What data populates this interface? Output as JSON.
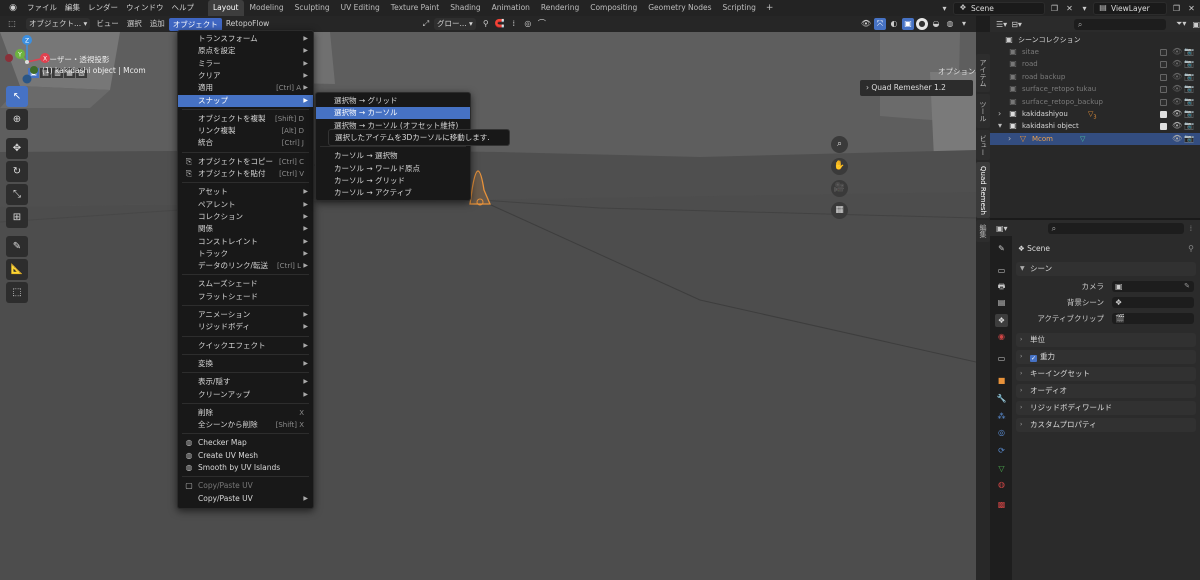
{
  "topbar": {
    "menus": [
      "ファイル",
      "編集",
      "レンダー",
      "ウィンドウ",
      "ヘルプ"
    ],
    "workspaces": [
      "Layout",
      "Modeling",
      "Sculpting",
      "UV Editing",
      "Texture Paint",
      "Shading",
      "Animation",
      "Rendering",
      "Compositing",
      "Geometry Nodes",
      "Scripting"
    ],
    "active_workspace": "Layout",
    "add_tab": "+",
    "scene_value": "Scene",
    "viewlayer_value": "ViewLayer"
  },
  "viewport_header": {
    "mode": "オブジェクト...",
    "menus": [
      "ビュー",
      "選択",
      "追加",
      "オブジェクト",
      "RetopoFlow"
    ],
    "active_menu": "オブジェクト",
    "transform_orientation": "グロー...",
    "options_label": "オプション"
  },
  "viewport": {
    "view_name": "ユーザー・透視投影",
    "object_info": "(1) kakidashi object | Mcom",
    "quad_remesher": "Quad Remesher 1.2",
    "gizmo_axes": {
      "x": "X",
      "y": "Y",
      "z": "Z"
    }
  },
  "sidebar_tabs": [
    "アイテム",
    "ツール",
    "ビュー",
    "Quad Remesh",
    "編集"
  ],
  "active_sidebar_tab": "Quad Remesh",
  "object_menu": {
    "items": [
      {
        "label": "トランスフォーム",
        "shortcut": "",
        "submenu": true
      },
      {
        "label": "原点を設定",
        "shortcut": "",
        "submenu": true
      },
      {
        "label": "ミラー",
        "shortcut": "",
        "submenu": true
      },
      {
        "label": "クリア",
        "shortcut": "",
        "submenu": true
      },
      {
        "label": "適用",
        "shortcut": "[Ctrl] A",
        "submenu": true
      },
      {
        "label": "スナップ",
        "shortcut": "",
        "submenu": true
      },
      {
        "label": "オブジェクトを複製",
        "shortcut": "[Shift] D",
        "submenu": false
      },
      {
        "label": "リンク複製",
        "shortcut": "[Alt] D",
        "submenu": false
      },
      {
        "label": "統合",
        "shortcut": "[Ctrl] J",
        "submenu": false
      },
      {
        "label": "オブジェクトをコピー",
        "shortcut": "[Ctrl] C",
        "submenu": false
      },
      {
        "label": "オブジェクトを貼付",
        "shortcut": "[Ctrl] V",
        "submenu": false
      },
      {
        "label": "アセット",
        "shortcut": "",
        "submenu": true
      },
      {
        "label": "ペアレント",
        "shortcut": "",
        "submenu": true
      },
      {
        "label": "コレクション",
        "shortcut": "",
        "submenu": true
      },
      {
        "label": "関係",
        "shortcut": "",
        "submenu": true
      },
      {
        "label": "コンストレイント",
        "shortcut": "",
        "submenu": true
      },
      {
        "label": "トラック",
        "shortcut": "",
        "submenu": true
      },
      {
        "label": "データのリンク/転送",
        "shortcut": "[Ctrl] L",
        "submenu": true
      },
      {
        "label": "スムーズシェード",
        "shortcut": "",
        "submenu": false
      },
      {
        "label": "フラットシェード",
        "shortcut": "",
        "submenu": false
      },
      {
        "label": "アニメーション",
        "shortcut": "",
        "submenu": true
      },
      {
        "label": "リジッドボディ",
        "shortcut": "",
        "submenu": true
      },
      {
        "label": "クイックエフェクト",
        "shortcut": "",
        "submenu": true
      },
      {
        "label": "変換",
        "shortcut": "",
        "submenu": true
      },
      {
        "label": "表示/隠す",
        "shortcut": "",
        "submenu": true
      },
      {
        "label": "クリーンアップ",
        "shortcut": "",
        "submenu": true
      },
      {
        "label": "削除",
        "shortcut": "X",
        "submenu": false
      },
      {
        "label": "全シーンから削除",
        "shortcut": "[Shift] X",
        "submenu": false
      },
      {
        "label": "Checker Map",
        "shortcut": "",
        "submenu": false
      },
      {
        "label": "Create UV Mesh",
        "shortcut": "",
        "submenu": false
      },
      {
        "label": "Smooth by UV Islands",
        "shortcut": "",
        "submenu": false
      },
      {
        "label": "Copy/Paste UV",
        "shortcut": "",
        "submenu": false
      },
      {
        "label": "Copy/Paste UV",
        "shortcut": "",
        "submenu": true
      }
    ],
    "highlighted": "スナップ"
  },
  "snap_submenu": {
    "items": [
      "選択物 → グリッド",
      "選択物 → カーソル",
      "選択物 → カーソル (オフセット維持)",
      "選択物 → アクティブ",
      "カーソル → 選択物",
      "カーソル → ワールド原点",
      "カーソル → グリッド",
      "カーソル → アクティブ"
    ],
    "highlighted": "選択物 → カーソル"
  },
  "tooltip": "選択したアイテムを3Dカーソルに移動します.",
  "outliner": {
    "root": "シーンコレクション",
    "rows": [
      {
        "name": "sitae",
        "dim": true
      },
      {
        "name": "road",
        "dim": true
      },
      {
        "name": "road backup",
        "dim": true
      },
      {
        "name": "surface_retopo tukau",
        "dim": true
      },
      {
        "name": "surface_retopo_backup",
        "dim": true
      },
      {
        "name": "kakidashiyou",
        "dim": false,
        "badge": "3"
      },
      {
        "name": "kakidashi object",
        "dim": false
      },
      {
        "name": "Mcom",
        "dim": false,
        "selected": true
      }
    ]
  },
  "properties": {
    "scene_name": "Scene",
    "section_scene": "シーン",
    "camera_label": "カメラ",
    "background_label": "背景シーン",
    "active_clip_label": "アクティブクリップ",
    "panels": [
      "単位",
      "重力",
      "キーイングセット",
      "オーディオ",
      "リジッドボディワールド",
      "カスタムプロパティ"
    ]
  },
  "colors": {
    "accent": "#4672c4",
    "object_orange": "#e8923a",
    "axis_x": "#e0414f",
    "axis_y": "#6db33f",
    "axis_z": "#3c8fe0"
  }
}
